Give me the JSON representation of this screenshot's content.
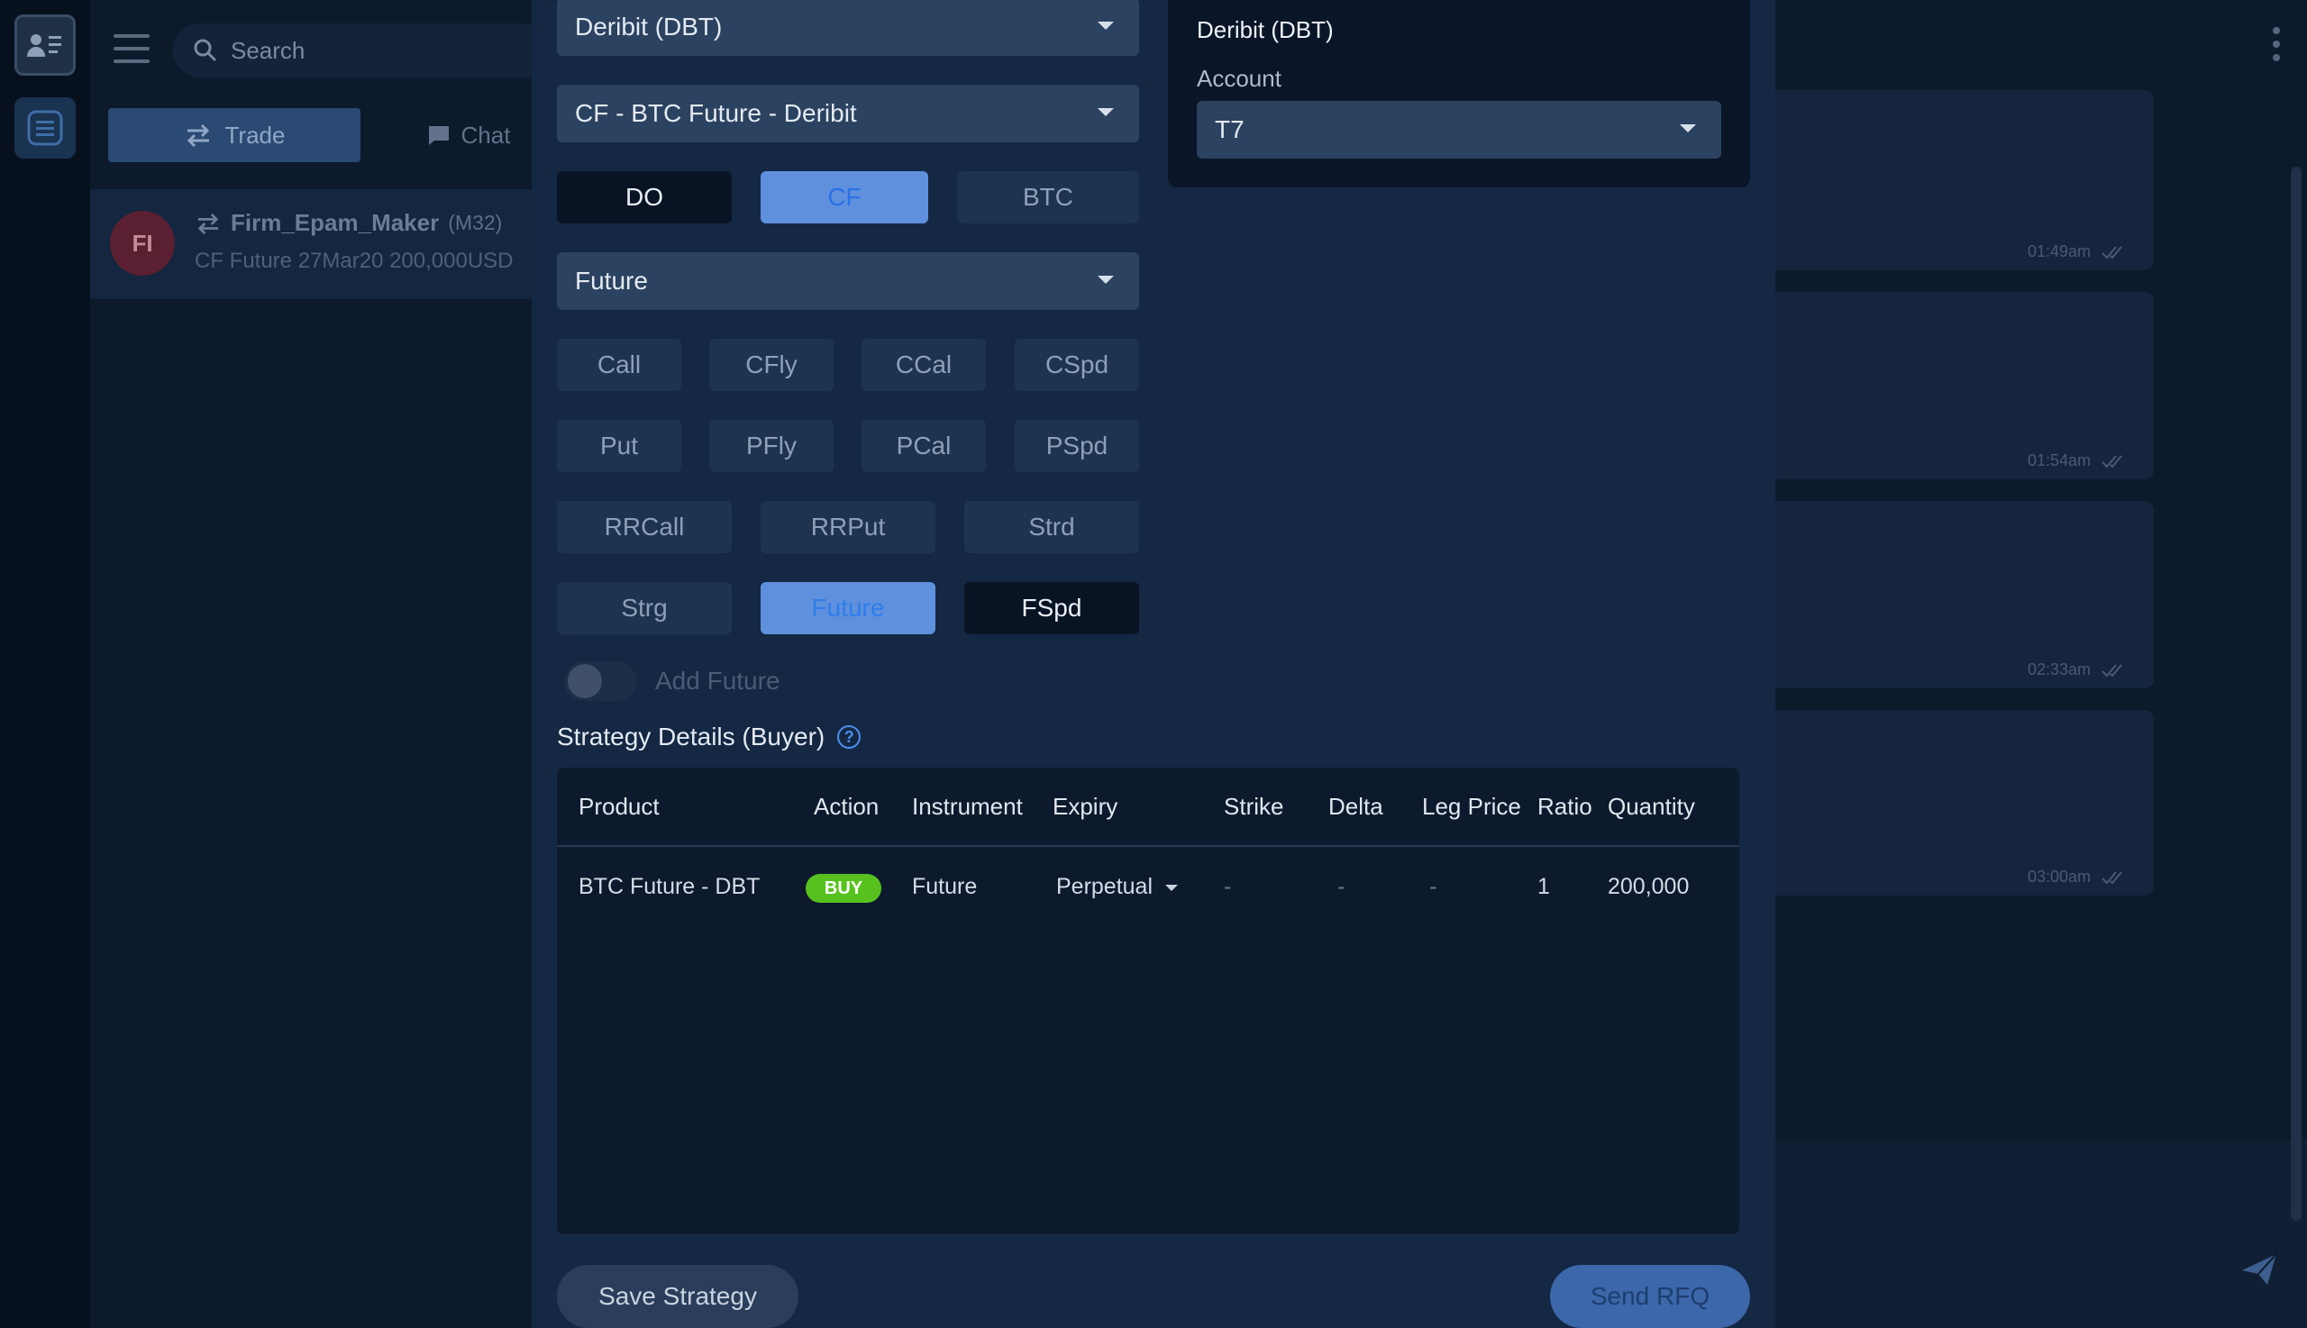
{
  "search": {
    "placeholder": "Search"
  },
  "tabs": {
    "trade": "Trade",
    "chat": "Chat"
  },
  "chat_item": {
    "initials": "FI",
    "name": "Firm_Epam_Maker",
    "code": "(M32)",
    "subtitle": "CF Future 27Mar20 200,000USD"
  },
  "messages": [
    {
      "time": "01:49am"
    },
    {
      "time": "01:54am"
    },
    {
      "time": "02:33am"
    },
    {
      "time": "03:00am"
    }
  ],
  "form": {
    "exchange": "Deribit (DBT)",
    "product": "CF - BTC Future - Deribit",
    "type_select": "Future",
    "group_buttons": [
      "DO",
      "CF",
      "BTC"
    ],
    "strategy_buttons_row1": [
      "Call",
      "CFly",
      "CCal",
      "CSpd"
    ],
    "strategy_buttons_row2": [
      "Put",
      "PFly",
      "PCal",
      "PSpd"
    ],
    "strategy_buttons_row3": [
      "RRCall",
      "RRPut",
      "Strd"
    ],
    "strategy_buttons_row4": [
      "Strg",
      "Future",
      "FSpd"
    ],
    "add_future_label": "Add Future",
    "add_future_on": false
  },
  "account_card": {
    "title": "Deribit (DBT)",
    "account_label": "Account",
    "account_value": "T7"
  },
  "strategy": {
    "title": "Strategy Details (Buyer)",
    "help_icon": "question-circle-icon",
    "columns": [
      "Product",
      "Action",
      "Instrument",
      "Expiry",
      "Strike",
      "Delta",
      "Leg Price",
      "Ratio",
      "Quantity"
    ],
    "rows": [
      {
        "product": "BTC Future - DBT",
        "action": "BUY",
        "instrument": "Future",
        "expiry": "Perpetual",
        "strike": "-",
        "delta": "-",
        "leg_price": "-",
        "ratio": "1",
        "quantity": "200,000"
      }
    ]
  },
  "actions": {
    "save": "Save Strategy",
    "send": "Send RFQ"
  },
  "colors": {
    "accent": "#5e90de",
    "buy": "#57c21e",
    "avatar": "#5a1f30"
  }
}
